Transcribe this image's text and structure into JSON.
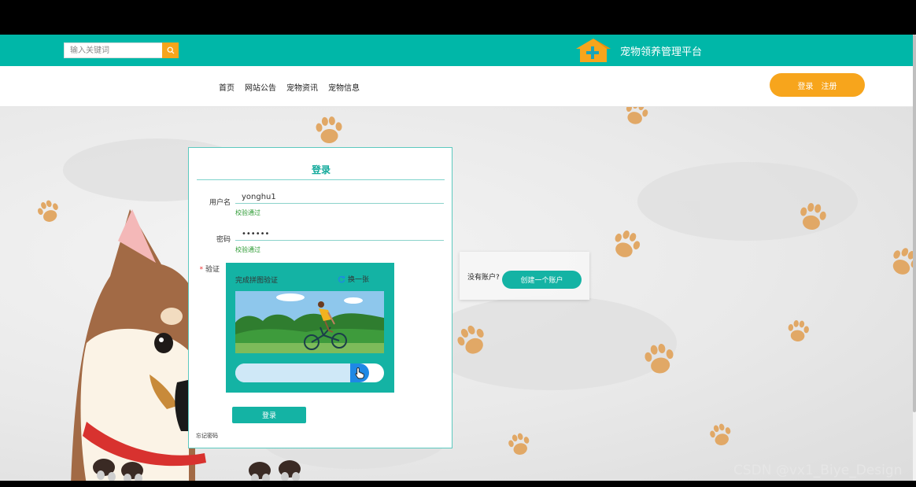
{
  "header": {
    "search_placeholder": "输入关键词",
    "site_title": "宠物领养管理平台",
    "accent_color": "#00b7a8"
  },
  "nav": {
    "items": [
      "首页",
      "网站公告",
      "宠物资讯",
      "宠物信息"
    ],
    "login": "登录",
    "register": "注册"
  },
  "login_form": {
    "title": "登录",
    "username_label": "用户名",
    "username_value": "yonghu1",
    "username_hint": "校验通过",
    "password_label": "密码",
    "password_value": "123456",
    "password_hint": "校验通过",
    "required_mark": "*",
    "captcha_label": "验证",
    "submit": "登录",
    "forgot_password": "忘记密码"
  },
  "captcha": {
    "title": "完成拼图验证",
    "refresh": "换一张",
    "slider_progress_pct": 80
  },
  "signup": {
    "no_account": "没有账户?",
    "create_button": "创建一个账户"
  },
  "watermark": "CSDN @vx1_Biye_Design"
}
